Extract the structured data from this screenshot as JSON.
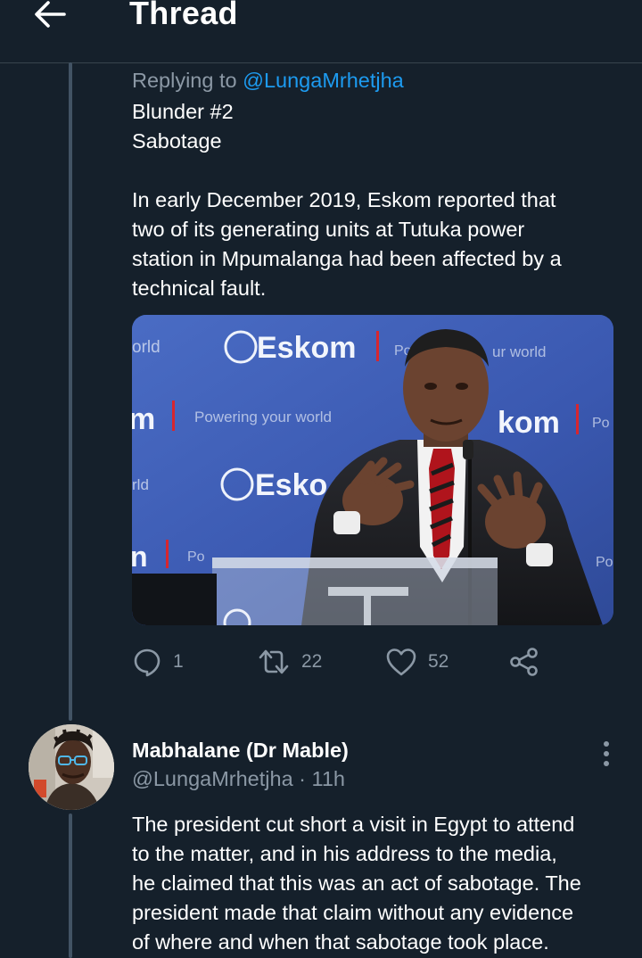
{
  "header": {
    "title": "Thread",
    "back_icon": "arrow-left-icon"
  },
  "reply_context": {
    "prefix": "Replying to",
    "handle": "@LungaMrhetjha"
  },
  "tweet1": {
    "lines": [
      "Blunder #2",
      "Sabotage",
      "In early December 2019, Eskom reported that",
      "two of its generating units at Tutuka power",
      "station in Mpumalanga had been affected by a",
      "technical fault."
    ],
    "image": {
      "backdrop_texts": [
        "orld",
        "Eskom",
        "Pow",
        "ur world",
        "m",
        "Powering your world",
        "kom",
        "Po",
        "rld",
        "Esko",
        "n",
        "Po",
        "Po"
      ]
    },
    "stats": {
      "replies": "1",
      "retweets": "22",
      "likes": "52"
    }
  },
  "tweet2": {
    "author_name": "Mabhalane (Dr Mable)",
    "handle": "@LungaMrhetjha",
    "separator": "·",
    "time": "11h",
    "lines": [
      "The president cut short a visit in Egypt to attend",
      "to the matter, and in his address to the media,",
      "he claimed that this was an act of sabotage. The",
      "president made that claim without any evidence",
      "of where and when that sabotage took place."
    ]
  },
  "colors": {
    "background": "#15202b",
    "text": "#ffffff",
    "secondary": "#8b98a5",
    "link": "#1d9bf0",
    "thread_line": "#425364",
    "backdrop_blue": "#3a5bb0"
  }
}
